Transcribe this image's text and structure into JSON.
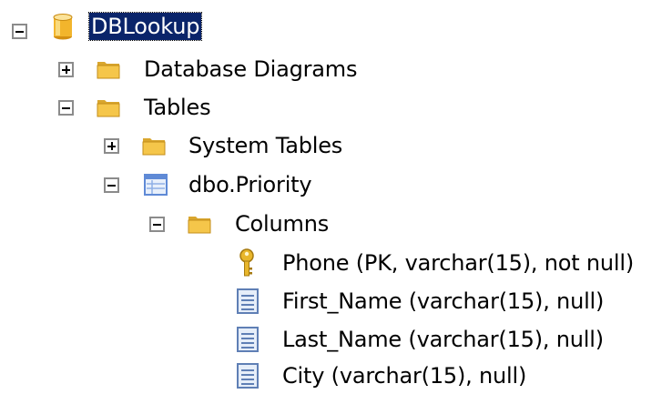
{
  "tree": {
    "root": {
      "label": "DBLookup",
      "icon": "database-icon",
      "state": "expanded",
      "selected": true
    },
    "database_diagrams": {
      "label": "Database Diagrams",
      "icon": "folder-icon",
      "state": "collapsed"
    },
    "tables": {
      "label": "Tables",
      "icon": "folder-icon",
      "state": "expanded"
    },
    "system_tables": {
      "label": "System Tables",
      "icon": "folder-icon",
      "state": "collapsed"
    },
    "priority_table": {
      "label": "dbo.Priority",
      "icon": "table-icon",
      "state": "expanded"
    },
    "columns_folder": {
      "label": "Columns",
      "icon": "folder-icon",
      "state": "expanded"
    },
    "columns": [
      {
        "label": "Phone (PK, varchar(15), not null)",
        "icon": "primary-key-icon"
      },
      {
        "label": "First_Name (varchar(15), null)",
        "icon": "column-icon"
      },
      {
        "label": "Last_Name (varchar(15), null)",
        "icon": "column-icon"
      },
      {
        "label": "City (varchar(15), null)",
        "icon": "column-icon"
      }
    ]
  },
  "colors": {
    "selection_bg": "#0a246a",
    "folder_fill": "#f5c64a",
    "database_fill": "#f2b52c",
    "table_icon": "#5f8ad6",
    "key_fill": "#e8b62b"
  }
}
